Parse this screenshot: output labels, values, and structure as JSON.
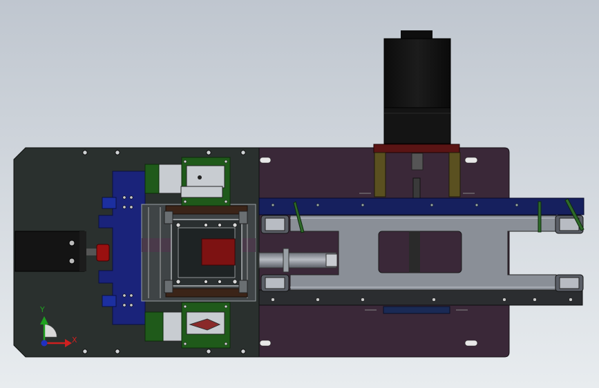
{
  "viewport": {
    "background_top": "#bfc6cf",
    "background_bottom": "#e8ecef"
  },
  "model": {
    "left_plate_color": "#2a302e",
    "right_plate_color": "#3a2838",
    "blue_part_color": "#1a237a",
    "red_part_color": "#8a1414",
    "green_part_color": "#1f5a1a",
    "motor_color": "#121212",
    "gray_part_color": "#8a8f97"
  },
  "triad": {
    "x_label": "X",
    "y_label": "Y",
    "x_color": "#d02020",
    "y_color": "#20a020",
    "z_color": "#2030c0"
  }
}
